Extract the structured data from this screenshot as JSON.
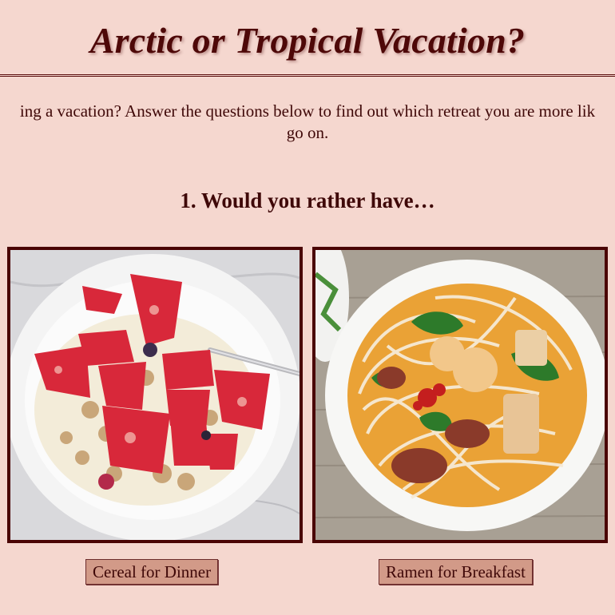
{
  "header": {
    "title": "Arctic or Tropical Vacation?"
  },
  "intro": {
    "text": "ing a vacation? Answer the questions below to find out which retreat you are more lik\ngo on."
  },
  "quiz": {
    "question": "1. Would you rather have…",
    "options": [
      {
        "label": "Cereal for Dinner",
        "image": "strawberry-cereal-bowl-photo"
      },
      {
        "label": "Ramen for Breakfast",
        "image": "ramen-noodle-bowl-photo"
      }
    ]
  },
  "colors": {
    "background": "#f5d7cf",
    "accent": "#4e0808",
    "button": "#d29a88"
  }
}
